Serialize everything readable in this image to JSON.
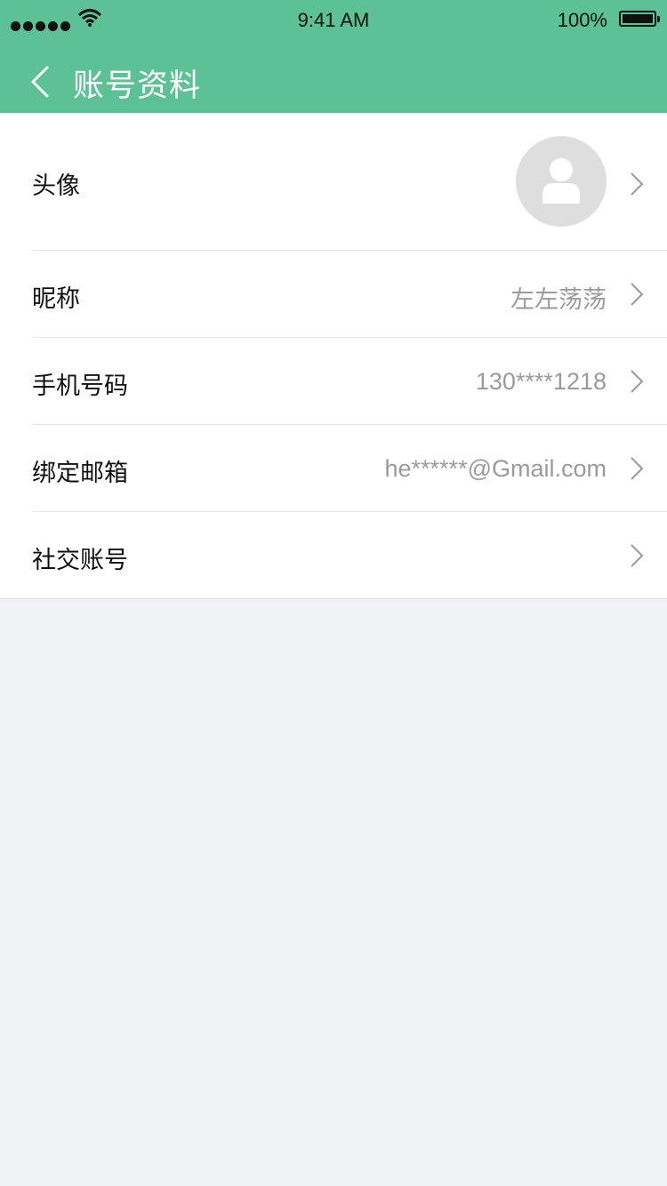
{
  "status_bar": {
    "time": "9:41 AM",
    "battery": "100%"
  },
  "nav": {
    "title": "账号资料"
  },
  "rows": [
    {
      "label": "头像",
      "value": ""
    },
    {
      "label": "昵称",
      "value": "左左荡荡"
    },
    {
      "label": "手机号码",
      "value": "130****1218"
    },
    {
      "label": "绑定邮箱",
      "value": "he******@Gmail.com"
    },
    {
      "label": "社交账号",
      "value": ""
    }
  ],
  "colors": {
    "accent": "#5cc194",
    "background": "#f1f2f6"
  }
}
